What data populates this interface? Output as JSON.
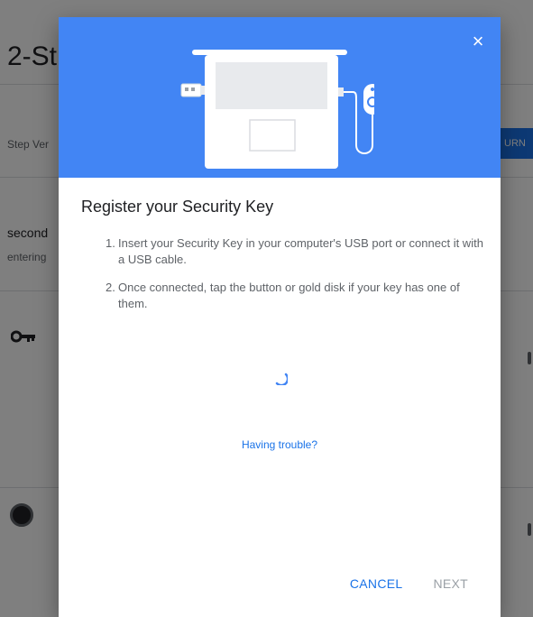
{
  "background": {
    "page_title": "2-St",
    "setting_label": "Step Ver",
    "turn_button_label": "URN O",
    "second_line_1": "second",
    "second_line_2": "entering"
  },
  "dialog": {
    "title": "Register your Security Key",
    "steps": [
      {
        "number": "1.",
        "text": "Insert your Security Key in your computer's USB port or connect it with a USB cable."
      },
      {
        "number": "2.",
        "text": "Once connected, tap the button or gold disk if your key has one of them."
      }
    ],
    "trouble_link": "Having trouble?",
    "cancel_label": "CANCEL",
    "next_label": "NEXT",
    "close_glyph": "×"
  },
  "colors": {
    "header_blue": "#4285f4",
    "link_blue": "#1a73e8",
    "disabled_grey": "#9aa0a6"
  },
  "icons": {
    "close": "close-icon",
    "illustration": "laptop-usb-key-illustration",
    "loading": "loading-spinner-icon",
    "background_key": "key-icon"
  }
}
